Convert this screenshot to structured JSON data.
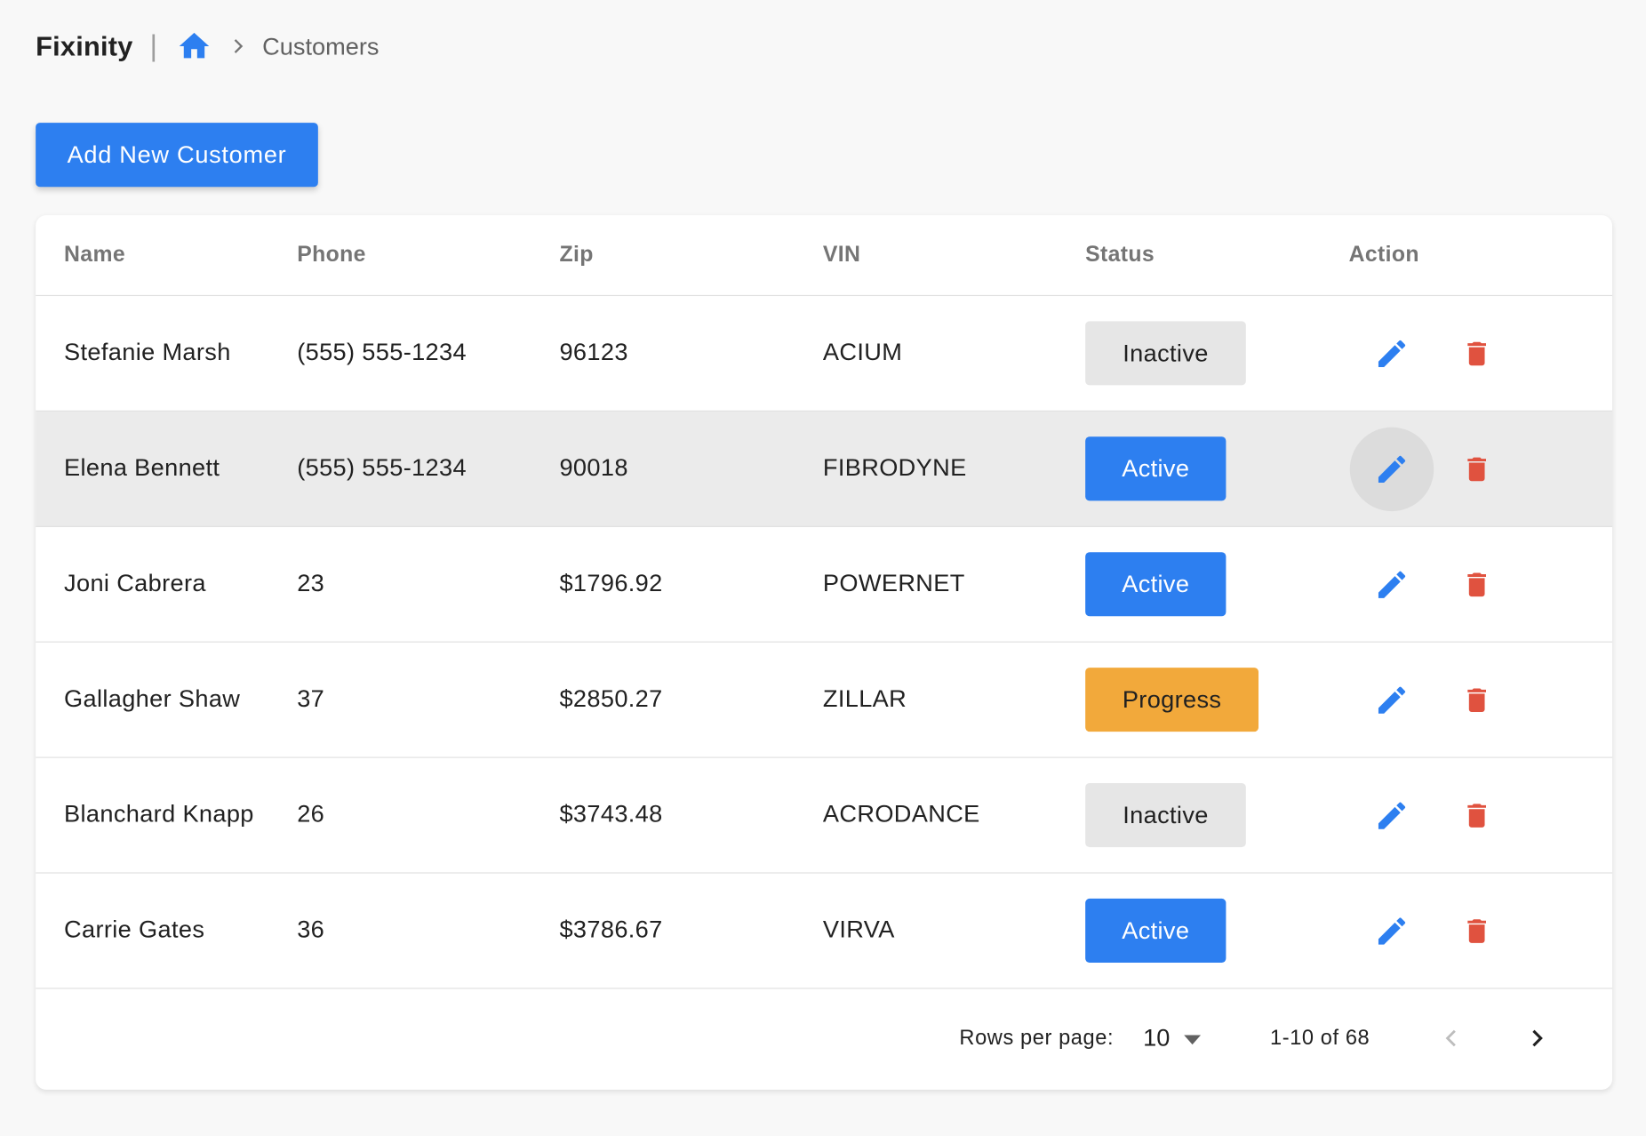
{
  "app": {
    "brand": "Fixinity",
    "separator": "|",
    "breadcrumb_current": "Customers"
  },
  "toolbar": {
    "add_label": "Add New Customer"
  },
  "table": {
    "columns": [
      "Name",
      "Phone",
      "Zip",
      "VIN",
      "Status",
      "Action"
    ],
    "rows": [
      {
        "name": "Stefanie Marsh",
        "phone": "(555) 555-1234",
        "zip": "96123",
        "vin": "ACIUM",
        "status": "Inactive"
      },
      {
        "name": "Elena Bennett",
        "phone": "(555) 555-1234",
        "zip": "90018",
        "vin": "FIBRODYNE",
        "status": "Active"
      },
      {
        "name": "Joni Cabrera",
        "phone": "23",
        "zip": "$1796.92",
        "vin": "POWERNET",
        "status": "Active"
      },
      {
        "name": "Gallagher Shaw",
        "phone": "37",
        "zip": "$2850.27",
        "vin": "ZILLAR",
        "status": "Progress"
      },
      {
        "name": "Blanchard Knapp",
        "phone": "26",
        "zip": "$3743.48",
        "vin": "ACRODANCE",
        "status": "Inactive"
      },
      {
        "name": "Carrie Gates",
        "phone": "36",
        "zip": "$3786.67",
        "vin": "VIRVA",
        "status": "Active"
      }
    ]
  },
  "pagination": {
    "rows_per_page_label": "Rows per page:",
    "rows_per_page": "10",
    "range": "1-10 of 68"
  },
  "colors": {
    "primary": "#2d7ff0",
    "danger": "#e0523f",
    "warning": "#f2a93b",
    "inactive": "#e6e6e6"
  },
  "icons": {
    "home": "home-icon",
    "chevron": "chevron-right-icon",
    "edit": "pencil-icon",
    "delete": "trash-icon",
    "dropdown": "caret-down-icon",
    "prev": "chevron-left-icon",
    "next": "chevron-right-icon"
  }
}
